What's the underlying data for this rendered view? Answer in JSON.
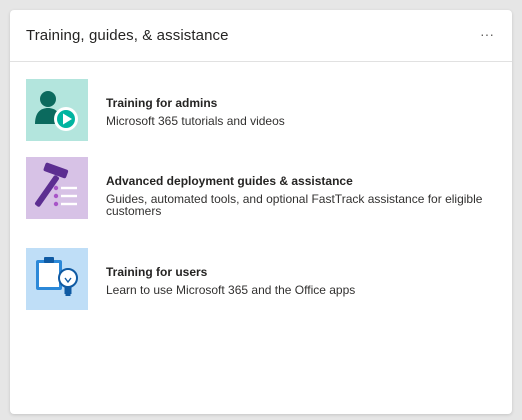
{
  "card": {
    "title": "Training, guides, & assistance",
    "more_label": "···"
  },
  "items": [
    {
      "title": "Training for admins",
      "description": "Microsoft 365 tutorials and videos",
      "icon": "admin-training-icon",
      "tile_color": "#b3e5dd"
    },
    {
      "title": "Advanced deployment guides & assistance",
      "description": "Guides, automated tools, and optional FastTrack assistance for eligible customers",
      "icon": "deployment-guide-icon",
      "tile_color": "#d7c2e6"
    },
    {
      "title": "Training for users",
      "description": "Learn to use Microsoft 365 and the Office apps",
      "icon": "user-training-icon",
      "tile_color": "#bfdef7"
    }
  ]
}
